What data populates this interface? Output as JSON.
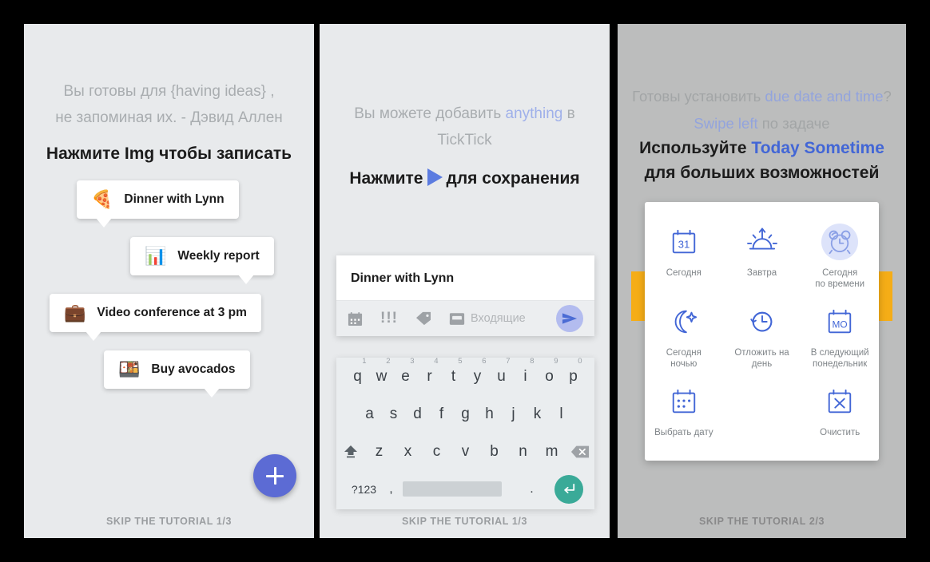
{
  "colors": {
    "panel_bg_light": "#e8eaec",
    "panel_bg_dim": "#bcbdbd",
    "accent_blue": "#5c6bd4",
    "accent_light_blue": "#9fb0ea",
    "accent_strong_blue": "#4266d6",
    "send_circle": "#b3bcef",
    "enter_teal": "#3aaa98",
    "swipe_amber": "#f5ad17",
    "picker_icon_blue": "#4266d6",
    "grey_text": "#a9adb0"
  },
  "panel1": {
    "quote_line1_a": "Вы готовы для ",
    "quote_line1_b": "{having ideas}",
    "quote_line1_c": " ,",
    "quote_line2": "не запоминая их. - Дэвид Аллен",
    "cta": "Нажмите  Img  чтобы записать",
    "tasks": [
      {
        "emoji": "🍕",
        "label": "Dinner with Lynn"
      },
      {
        "emoji": "📊",
        "label": "Weekly report"
      },
      {
        "emoji": "💼",
        "label": "Video conference at 3 pm"
      },
      {
        "emoji": "🍱",
        "label": "Buy avocados"
      }
    ],
    "fab": "add-task",
    "skip": "SKIP THE TUTORIAL 1/3"
  },
  "panel2": {
    "head_a": "Вы можете добавить ",
    "head_b": "anything",
    "head_c": " в TickTick",
    "cta_a": "Нажмите",
    "cta_b": "для сохранения",
    "compose": {
      "title": "Dinner with Lynn",
      "icons": [
        "calendar-icon",
        "priority-icon",
        "tag-icon",
        "inbox-icon"
      ],
      "priority_glyph": "!!!",
      "inbox_label": "Входящие",
      "send_label": "send-icon"
    },
    "keyboard": {
      "row1": [
        {
          "key": "q",
          "num": "1"
        },
        {
          "key": "w",
          "num": "2"
        },
        {
          "key": "e",
          "num": "3"
        },
        {
          "key": "r",
          "num": "4"
        },
        {
          "key": "t",
          "num": "5"
        },
        {
          "key": "y",
          "num": "6"
        },
        {
          "key": "u",
          "num": "7"
        },
        {
          "key": "i",
          "num": "8"
        },
        {
          "key": "o",
          "num": "9"
        },
        {
          "key": "p",
          "num": "0"
        }
      ],
      "row2": [
        "a",
        "s",
        "d",
        "f",
        "g",
        "h",
        "j",
        "k",
        "l"
      ],
      "row3": [
        "z",
        "x",
        "c",
        "v",
        "b",
        "n",
        "m"
      ],
      "shift": "shift-icon",
      "backspace": "backspace-icon",
      "symbols": "?123",
      "comma": ",",
      "period": ".",
      "space": "spacebar",
      "enter": "enter-icon"
    },
    "skip": "SKIP THE TUTORIAL 1/3"
  },
  "panel3": {
    "head_back_a": "Готовы установить ",
    "head_back_b": "due date and time",
    "head_back_c": "?",
    "head_back2_a": "Swipe left",
    "head_back2_b": " по задаче",
    "head_front_a": "Используйте ",
    "head_front_b": "Today Sometime",
    "head_front_c": " для больших возможностей",
    "picker": [
      [
        {
          "icon": "calendar-31-icon",
          "label": "Сегодня",
          "highlighted": false
        },
        {
          "icon": "sunrise-icon",
          "label": "Завтра",
          "highlighted": false
        },
        {
          "icon": "alarm-clock-icon",
          "label": "Сегодня\nпо времени",
          "label_l1": "Сегодня",
          "label_l2": "по времени",
          "highlighted": true
        }
      ],
      [
        {
          "icon": "moon-star-icon",
          "label_l1": "Сегодня",
          "label_l2": "ночью"
        },
        {
          "icon": "clock-back-icon",
          "label_l1": "Отложить на",
          "label_l2": "день"
        },
        {
          "icon": "calendar-mo-icon",
          "label_l1": "В следующий",
          "label_l2": "понедельник"
        }
      ],
      [
        {
          "icon": "calendar-dots-icon",
          "label_l1": "Выбрать дату",
          "label_l2": ""
        },
        {
          "icon": "calendar-x-icon",
          "label_l1": "Очистить",
          "label_l2": ""
        }
      ]
    ],
    "calendar_31": "31",
    "calendar_mo": "MO",
    "skip": "SKIP THE TUTORIAL 2/3"
  }
}
